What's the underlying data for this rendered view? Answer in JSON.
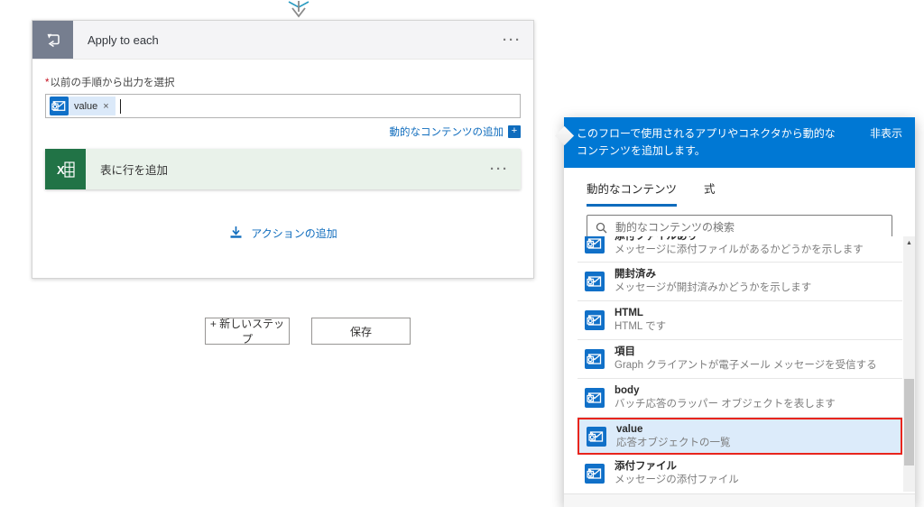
{
  "colors": {
    "accent": "#0078d4",
    "link": "#0f6cbd",
    "excel": "#217346",
    "loopgray": "#767e8f",
    "red": "#e8251d",
    "chipbg": "#dbe9f9",
    "selbg": "#dcebfa"
  },
  "flow": {
    "apply_card": {
      "title": "Apply to each",
      "menu_icon": "···",
      "required_marker": "*",
      "field_label": "以前の手順から出力を選択",
      "chip": {
        "label": "value",
        "remove_icon": "×"
      },
      "dynamic_content_link": "動的なコンテンツの追加",
      "plus_icon": "+",
      "excel_card": {
        "title": "表に行を追加",
        "menu_icon": "···"
      },
      "add_action_label": "アクションの追加"
    },
    "new_step_button": "+ 新しいステップ",
    "save_button": "保存"
  },
  "panel": {
    "header": {
      "message": "このフローで使用されるアプリやコネクタから動的なコンテンツを追加します。",
      "hide_link": "非表示"
    },
    "tabs": {
      "dynamic": "動的なコンテンツ",
      "expression": "式"
    },
    "search_placeholder": "動的なコンテンツの検索",
    "scroll_up_icon": "▲",
    "items": [
      {
        "title": "添付ファイルあり",
        "desc": "メッセージに添付ファイルがあるかどうかを示します"
      },
      {
        "title": "開封済み",
        "desc": "メッセージが開封済みかどうかを示します"
      },
      {
        "title": "HTML",
        "desc": "HTML です"
      },
      {
        "title": "項目",
        "desc": "Graph クライアントが電子メール メッセージを受信する"
      },
      {
        "title": "body",
        "desc": "バッチ応答のラッパー オブジェクトを表します"
      },
      {
        "title": "value",
        "desc": "応答オブジェクトの一覧"
      },
      {
        "title": "添付ファイル",
        "desc": "メッセージの添付ファイル"
      }
    ]
  }
}
